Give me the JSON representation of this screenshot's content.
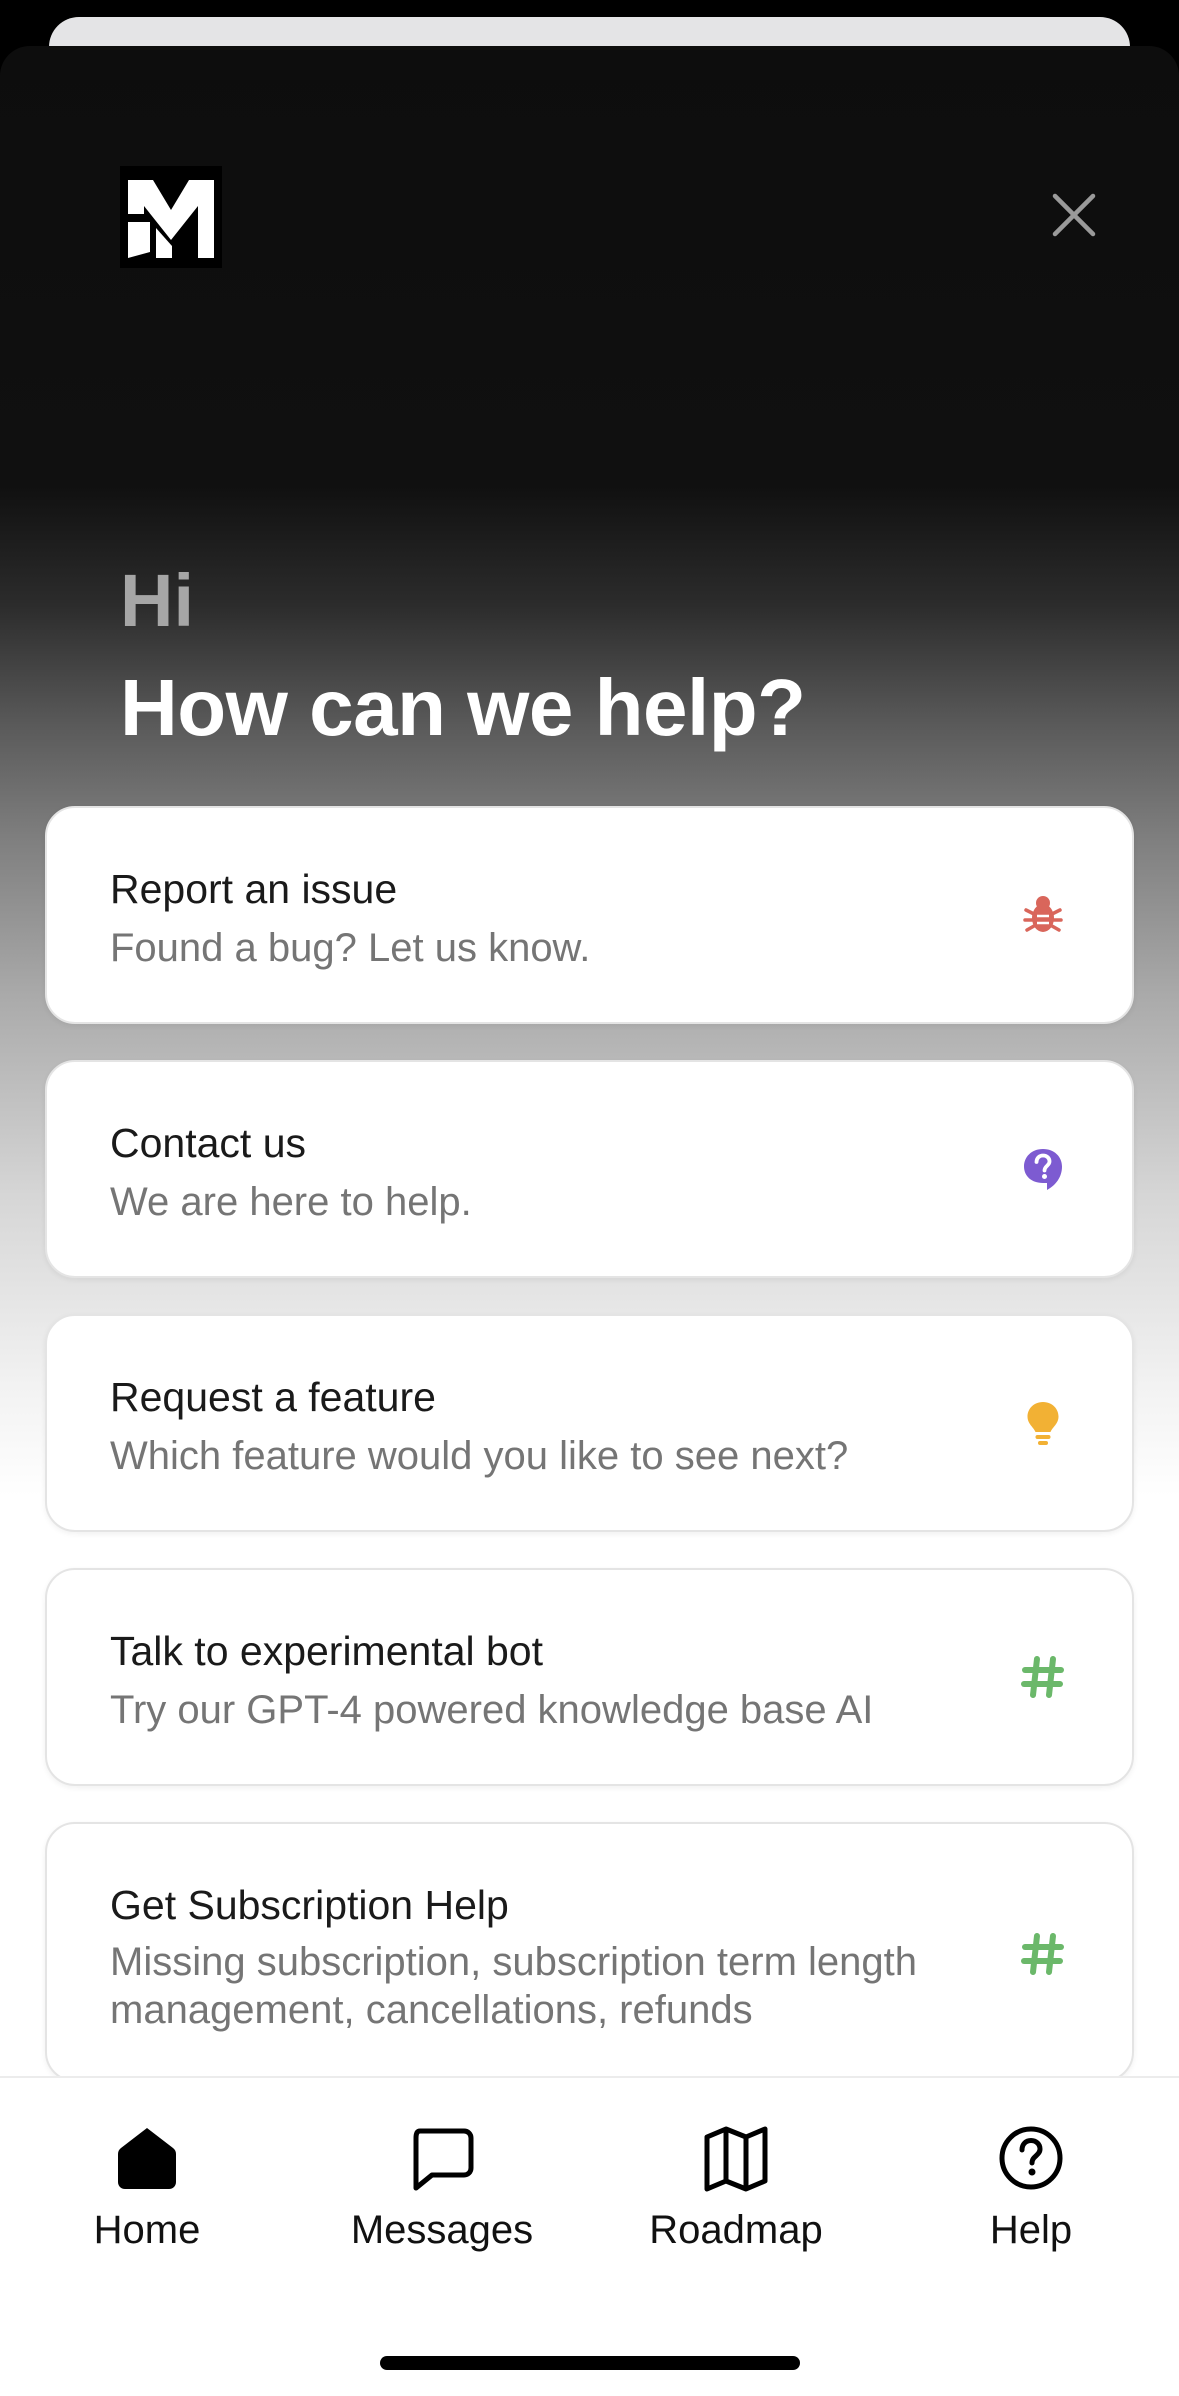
{
  "header": {
    "logo_icon": "mm-logo-icon",
    "close_icon": "close-icon",
    "greeting": "Hi",
    "headline": "How can we help?"
  },
  "cards": [
    {
      "title": "Report an issue",
      "subtitle": "Found a bug? Let us know.",
      "icon": "bug-icon",
      "icon_color": "#d9665b"
    },
    {
      "title": "Contact us",
      "subtitle": "We are here to help.",
      "icon": "question-bubble-icon",
      "icon_color": "#7d5bd1"
    },
    {
      "title": "Request a feature",
      "subtitle": "Which feature would you like to see next?",
      "icon": "lightbulb-icon",
      "icon_color": "#f2b134"
    },
    {
      "title": "Talk to experimental bot",
      "subtitle": "Try our GPT-4 powered knowledge base AI",
      "icon": "hashtag-icon",
      "icon_color": "#6bb86a"
    },
    {
      "title": "Get Subscription Help",
      "subtitle": "Missing subscription, subscription term length management, cancellations, refunds",
      "icon": "hashtag-icon",
      "icon_color": "#6bb86a"
    }
  ],
  "tabs": [
    {
      "label": "Home",
      "icon": "home-icon",
      "active": true
    },
    {
      "label": "Messages",
      "icon": "chat-bubble-icon",
      "active": false
    },
    {
      "label": "Roadmap",
      "icon": "map-icon",
      "active": false
    },
    {
      "label": "Help",
      "icon": "help-circle-icon",
      "active": false
    }
  ]
}
